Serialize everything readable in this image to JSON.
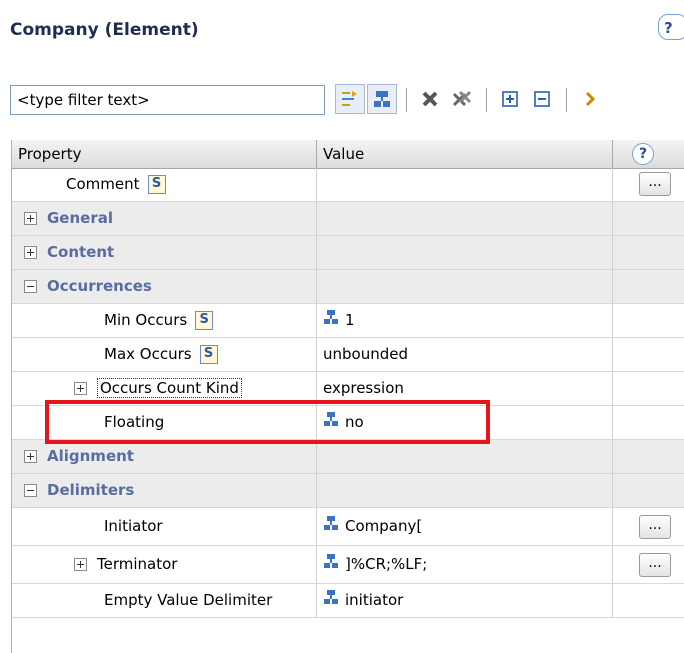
{
  "panel": {
    "title": "Company (Element)",
    "help_glyph": "?"
  },
  "filter": {
    "value": "<type filter text>"
  },
  "toolbar": {
    "buttons": [
      "show-categories-icon",
      "show-advanced-icon",
      "delete-icon",
      "delete-all-icon",
      "expand-all-icon",
      "collapse-all-icon",
      "more-icon"
    ]
  },
  "table": {
    "headers": {
      "property": "Property",
      "value": "Value",
      "help": "?"
    },
    "rows": [
      {
        "label": "Comment",
        "value": "",
        "ellipsis": "..."
      },
      {
        "label": "General"
      },
      {
        "label": "Content"
      },
      {
        "label": "Occurrences"
      },
      {
        "label": "Min Occurs",
        "value": "1"
      },
      {
        "label": "Max Occurs",
        "value": "unbounded"
      },
      {
        "label": "Occurs Count Kind",
        "value": "expression"
      },
      {
        "label": "Floating",
        "value": "no"
      },
      {
        "label": "Alignment"
      },
      {
        "label": "Delimiters"
      },
      {
        "label": "Initiator",
        "value": "Company[",
        "ellipsis": "..."
      },
      {
        "label": "Terminator",
        "value": "]%CR;%LF;",
        "ellipsis": "..."
      },
      {
        "label": "Empty Value Delimiter",
        "value": "initiator"
      }
    ]
  },
  "schema_icon_text": "S",
  "colors": {
    "highlight": "#e8141b",
    "category_text": "#5a6da0",
    "category_bg": "#ececec"
  }
}
